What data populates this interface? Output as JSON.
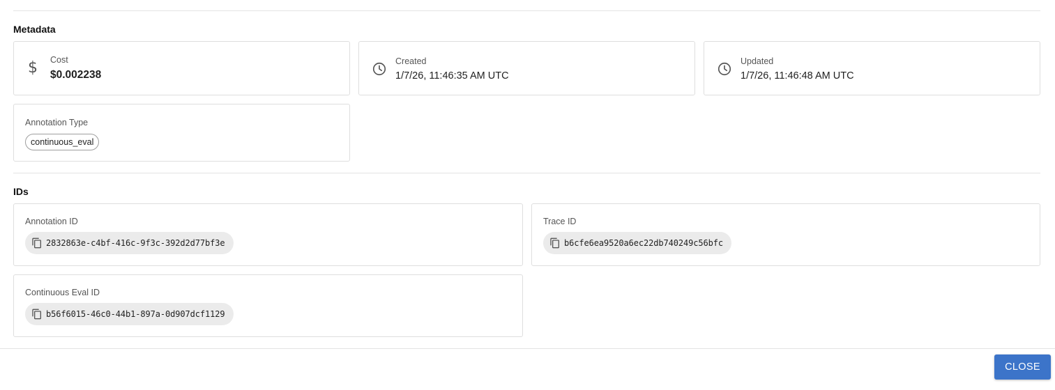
{
  "metadata": {
    "title": "Metadata",
    "cost": {
      "label": "Cost",
      "value": "$0.002238",
      "icon": "dollar-icon"
    },
    "created": {
      "label": "Created",
      "value": "1/7/26, 11:46:35 AM UTC",
      "icon": "clock-icon"
    },
    "updated": {
      "label": "Updated",
      "value": "1/7/26, 11:46:48 AM UTC",
      "icon": "clock-icon"
    },
    "annotation_type": {
      "label": "Annotation Type",
      "value": "continuous_eval"
    }
  },
  "ids": {
    "title": "IDs",
    "annotation_id": {
      "label": "Annotation ID",
      "value": "2832863e-c4bf-416c-9f3c-392d2d77bf3e",
      "icon": "copy-icon"
    },
    "trace_id": {
      "label": "Trace ID",
      "value": "b6cfe6ea9520a6ec22db740249c56bfc",
      "icon": "copy-icon"
    },
    "continuous_eval_id": {
      "label": "Continuous Eval ID",
      "value": "b56f6015-46c0-44b1-897a-0d907dcf1129",
      "icon": "copy-icon"
    }
  },
  "footer": {
    "close_label": "CLOSE"
  },
  "colors": {
    "accent": "#3c74c9",
    "chip_background": "#ebebeb",
    "border": "#dedede"
  }
}
